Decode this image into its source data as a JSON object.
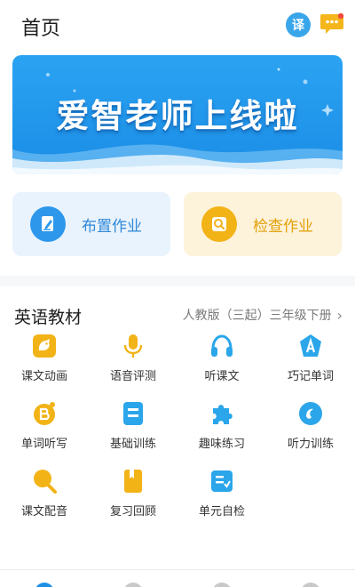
{
  "header": {
    "title": "首页",
    "translate_label": "译",
    "icons": [
      "translate-icon",
      "message-icon"
    ]
  },
  "banner": {
    "headline": "爱智老师上线啦"
  },
  "actions": [
    {
      "label": "布置作业",
      "icon": "pencil-icon",
      "color": "#2d97eb"
    },
    {
      "label": "检查作业",
      "icon": "search-icon",
      "color": "#f2b317"
    }
  ],
  "section": {
    "title": "英语教材",
    "textbook": "人教版（三起）三年级下册"
  },
  "features": [
    {
      "label": "课文动画",
      "icon": "animation-icon",
      "color": "#f2b317"
    },
    {
      "label": "语音评测",
      "icon": "microphone-icon",
      "color": "#f2b317"
    },
    {
      "label": "听课文",
      "icon": "headphones-icon",
      "color": "#2ba6ea"
    },
    {
      "label": "巧记单词",
      "icon": "letter-a-icon",
      "color": "#2ba6ea"
    },
    {
      "label": "单词听写",
      "icon": "letter-b-icon",
      "color": "#f2b317"
    },
    {
      "label": "基础训练",
      "icon": "basic-training-icon",
      "color": "#2ba6ea"
    },
    {
      "label": "趣味练习",
      "icon": "puzzle-icon",
      "color": "#2ba6ea"
    },
    {
      "label": "听力训练",
      "icon": "listening-icon",
      "color": "#2ba6ea"
    },
    {
      "label": "课文配音",
      "icon": "dubbing-icon",
      "color": "#f2b317"
    },
    {
      "label": "复习回顾",
      "icon": "book-icon",
      "color": "#f2b317"
    },
    {
      "label": "单元自检",
      "icon": "checklist-icon",
      "color": "#2ba6ea"
    }
  ],
  "colors": {
    "primary_blue": "#1e90e6",
    "accent_yellow": "#f2b317"
  }
}
